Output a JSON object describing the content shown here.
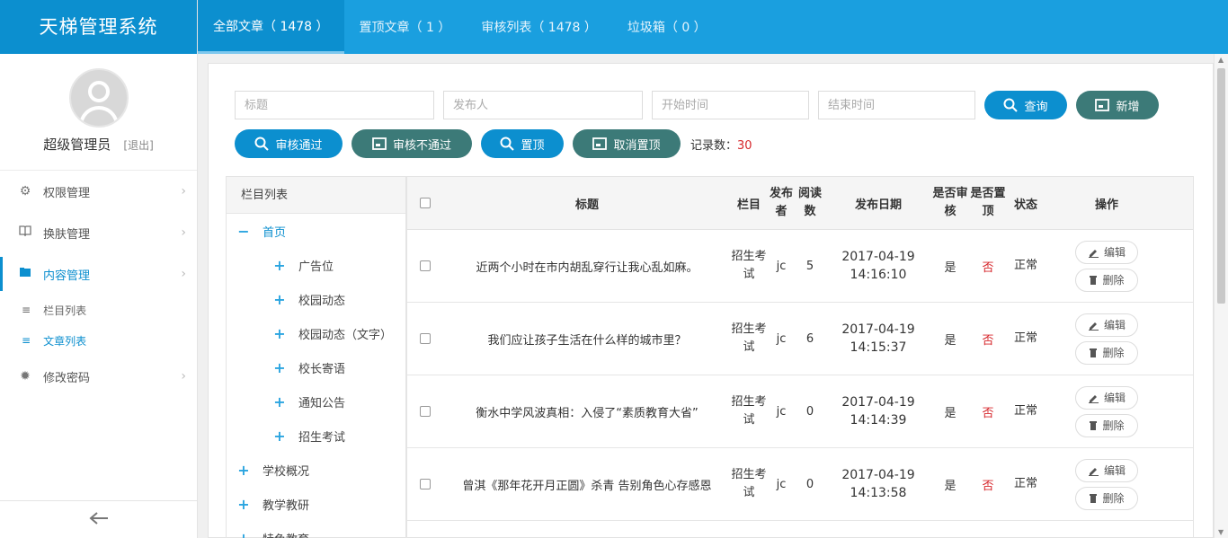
{
  "brand": "天梯管理系统",
  "user": {
    "name": "超级管理员",
    "logout": "[退出]"
  },
  "menu": [
    {
      "label": "权限管理",
      "icon": "gear-icon"
    },
    {
      "label": "换肤管理",
      "icon": "book-icon"
    },
    {
      "label": "内容管理",
      "icon": "folder-icon"
    },
    {
      "label": "修改密码",
      "icon": "cog-icon"
    }
  ],
  "submenu": [
    {
      "label": "栏目列表"
    },
    {
      "label": "文章列表"
    }
  ],
  "tabs": [
    {
      "label": "全部文章（ 1478 ）"
    },
    {
      "label": "置顶文章（ 1 ）"
    },
    {
      "label": "审核列表（ 1478 ）"
    },
    {
      "label": "垃圾箱（ 0 ）"
    }
  ],
  "filters": {
    "title_placeholder": "标题",
    "author_placeholder": "发布人",
    "start_placeholder": "开始时间",
    "end_placeholder": "结束时间",
    "search_label": "查询",
    "add_label": "新增"
  },
  "actions": {
    "approve": "审核通过",
    "reject": "审核不通过",
    "pin": "置顶",
    "unpin": "取消置顶",
    "record_label": "记录数：",
    "record_count": "30"
  },
  "tree": {
    "header": "栏目列表",
    "nodes": [
      {
        "label": "首页",
        "level": "root-open"
      },
      {
        "label": "广告位"
      },
      {
        "label": "校园动态"
      },
      {
        "label": "校园动态（文字）"
      },
      {
        "label": "校长寄语"
      },
      {
        "label": "通知公告"
      },
      {
        "label": "招生考试"
      },
      {
        "label": "学校概况"
      },
      {
        "label": "教学教研"
      },
      {
        "label": "特色教育"
      }
    ]
  },
  "table": {
    "headers": {
      "title": "标题",
      "column": "栏目",
      "publisher": "发布者",
      "reads": "阅读数",
      "date": "发布日期",
      "audited": "是否审核",
      "pinned": "是否置顶",
      "status": "状态",
      "ops": "操作"
    },
    "edit_label": "编辑",
    "delete_label": "删除",
    "rows": [
      {
        "title": "近两个小时在市内胡乱穿行让我心乱如麻。",
        "column": "招生考试",
        "publisher": "jc",
        "reads": "5",
        "date": "2017-04-19",
        "time": "14:16:10",
        "audited": "是",
        "pinned": "否",
        "status": "正常"
      },
      {
        "title": "我们应让孩子生活在什么样的城市里？",
        "column": "招生考试",
        "publisher": "jc",
        "reads": "6",
        "date": "2017-04-19",
        "time": "14:15:37",
        "audited": "是",
        "pinned": "否",
        "status": "正常"
      },
      {
        "title": "衡水中学风波真相：入侵了“素质教育大省”",
        "column": "招生考试",
        "publisher": "jc",
        "reads": "0",
        "date": "2017-04-19",
        "time": "14:14:39",
        "audited": "是",
        "pinned": "否",
        "status": "正常"
      },
      {
        "title": "曾淇《那年花开月正圆》杀青 告别角色心存感恩",
        "column": "招生考试",
        "publisher": "jc",
        "reads": "0",
        "date": "2017-04-19",
        "time": "14:13:58",
        "audited": "是",
        "pinned": "否",
        "status": "正常"
      }
    ]
  }
}
